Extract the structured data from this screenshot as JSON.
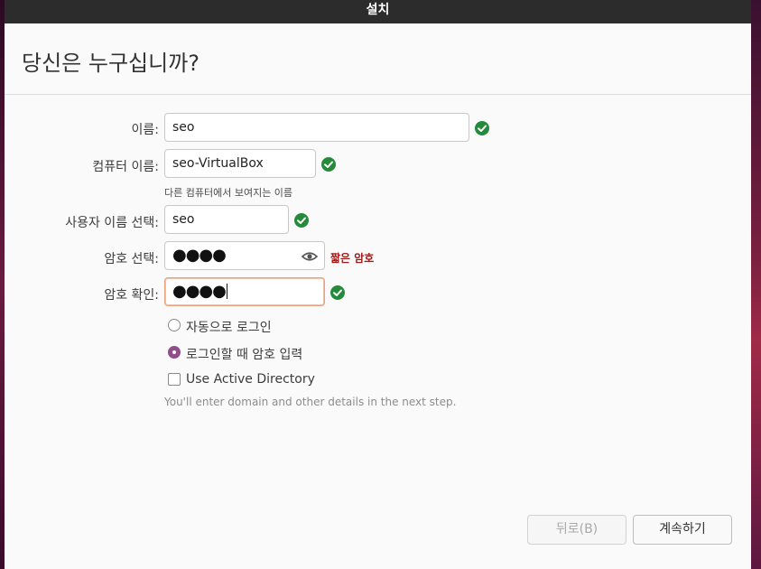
{
  "window": {
    "title": "설치"
  },
  "page": {
    "heading": "당신은 누구십니까?"
  },
  "form": {
    "name": {
      "label": "이름:",
      "value": "seo"
    },
    "computer_name": {
      "label": "컴퓨터 이름:",
      "value": "seo-VirtualBox",
      "hint": "다른 컴퓨터에서 보여지는 이름"
    },
    "username": {
      "label": "사용자 이름 선택:",
      "value": "seo"
    },
    "password": {
      "label": "암호 선택:",
      "value": "●●●●",
      "strength": "짧은 암호"
    },
    "confirm": {
      "label": "암호 확인:",
      "value": "●●●●"
    }
  },
  "login_options": {
    "auto_login": {
      "label": "자동으로 로그인",
      "selected": false
    },
    "require_password": {
      "label": "로그인할 때 암호 입력",
      "selected": true
    },
    "active_directory": {
      "label": "Use Active Directory",
      "checked": false,
      "note": "You'll enter domain and other details in the next step."
    }
  },
  "buttons": {
    "back": "뒤로(B)",
    "continue": "계속하기"
  },
  "colors": {
    "accent": "#924d8b",
    "success": "#268a3c",
    "warning": "#a11a1a",
    "focus_border": "#e9a07d"
  },
  "icons": {
    "valid": "check-circle-icon",
    "reveal": "eye-icon"
  }
}
